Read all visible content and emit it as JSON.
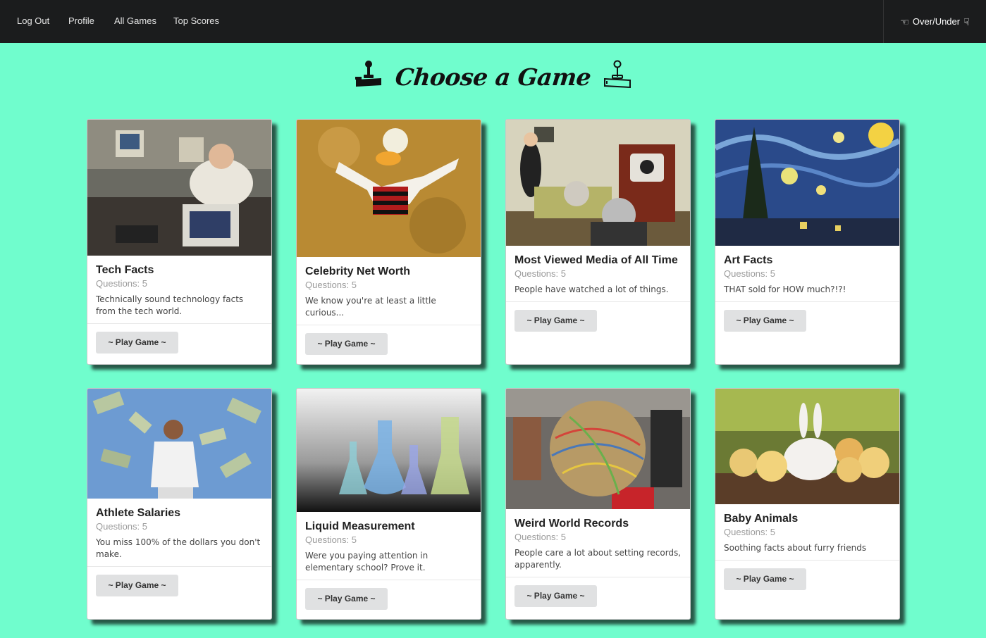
{
  "nav": {
    "items": [
      "Log Out",
      "Profile",
      "All Games",
      "Top Scores"
    ],
    "app_name": "Over/Under"
  },
  "header": {
    "title": "Choose a Game"
  },
  "cards": [
    {
      "title": "Tech Facts",
      "meta": "Questions: 5",
      "description": "Technically sound technology facts from the tech world.",
      "button": "~ Play Game ~"
    },
    {
      "title": "Celebrity Net Worth",
      "meta": "Questions: 5",
      "description": "We know you're at least a little curious...",
      "button": "~ Play Game ~"
    },
    {
      "title": "Most Viewed Media of All Time",
      "meta": "Questions: 5",
      "description": "People have watched a lot of things.",
      "button": "~ Play Game ~"
    },
    {
      "title": "Art Facts",
      "meta": "Questions: 5",
      "description": "THAT sold for HOW much?!?!",
      "button": "~ Play Game ~"
    },
    {
      "title": "Athlete Salaries",
      "meta": "Questions: 5",
      "description": "You miss 100% of the dollars you don't make.",
      "button": "~ Play Game ~"
    },
    {
      "title": "Liquid Measurement",
      "meta": "Questions: 5",
      "description": "Were you paying attention in elementary school? Prove it.",
      "button": "~ Play Game ~"
    },
    {
      "title": "Weird World Records",
      "meta": "Questions: 5",
      "description": "People care a lot about setting records, apparently.",
      "button": "~ Play Game ~"
    },
    {
      "title": "Baby Animals",
      "meta": "Questions: 5",
      "description": "Soothing facts about furry friends",
      "button": "~ Play Game ~"
    }
  ],
  "colors": {
    "background": "#70fdcd",
    "navbar": "#1b1c1d",
    "button": "#e0e1e2"
  }
}
